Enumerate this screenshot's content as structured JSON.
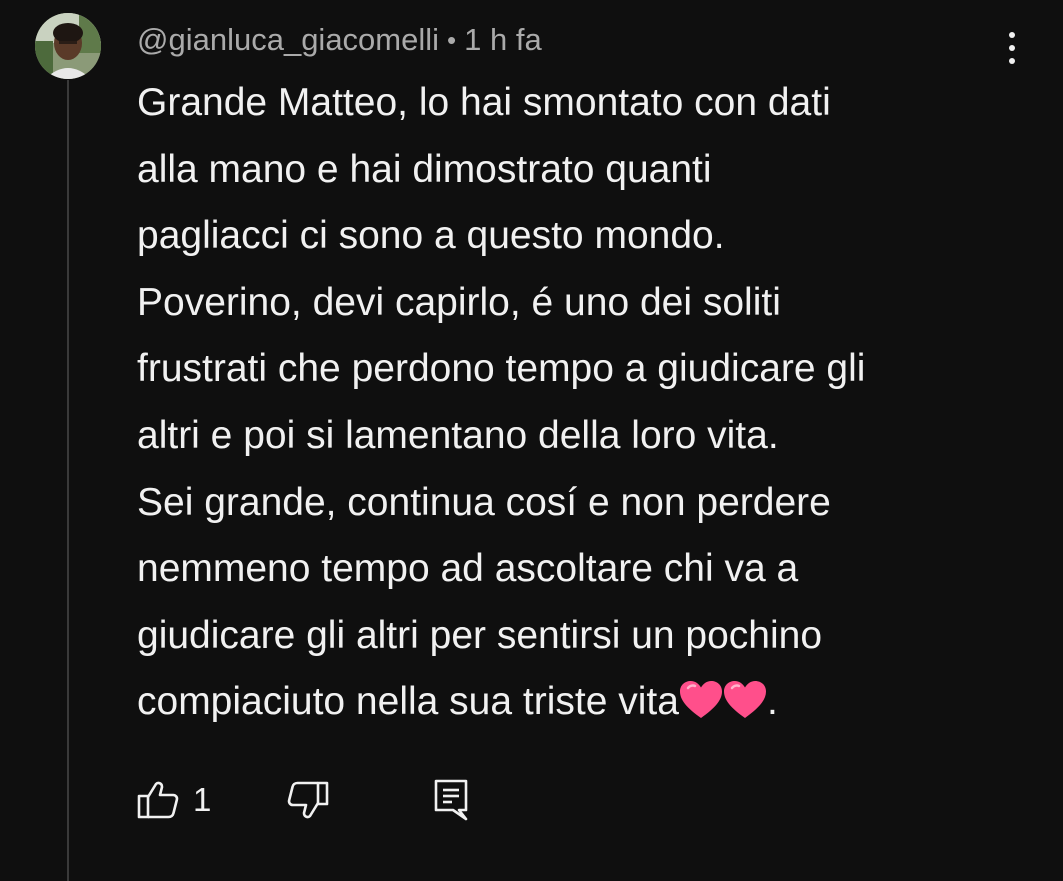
{
  "comment": {
    "author": "@gianluca_giacomelli",
    "separator": "•",
    "time": "1 h fa",
    "text_lines": [
      "Grande Matteo, lo hai smontato con dati",
      "alla mano e hai dimostrato quanti",
      "pagliacci ci sono a questo mondo.",
      "Poverino, devi capirlo, é uno dei soliti",
      "frustrati che perdono tempo a giudicare gli",
      "altri e poi si lamentano della loro vita.",
      "Sei grande, continua cosí e non perdere",
      "nemmeno tempo ad ascoltare chi va a",
      "giudicare gli altri per sentirsi un pochino",
      "compiaciuto nella sua triste vita"
    ],
    "text_end": ".",
    "like_count": "1"
  },
  "icons": {
    "avatar": "user-avatar",
    "menu": "more-vert-icon",
    "like": "thumb-up-icon",
    "dislike": "thumb-down-icon",
    "reply": "reply-comment-icon",
    "emoji": "pink-heart-emoji"
  },
  "colors": {
    "background": "#0f0f0f",
    "primary_text": "#f1f1f1",
    "secondary_text": "#aaaaaa",
    "thread_line": "#3a3a3a",
    "heart": "#ff4f8b"
  }
}
